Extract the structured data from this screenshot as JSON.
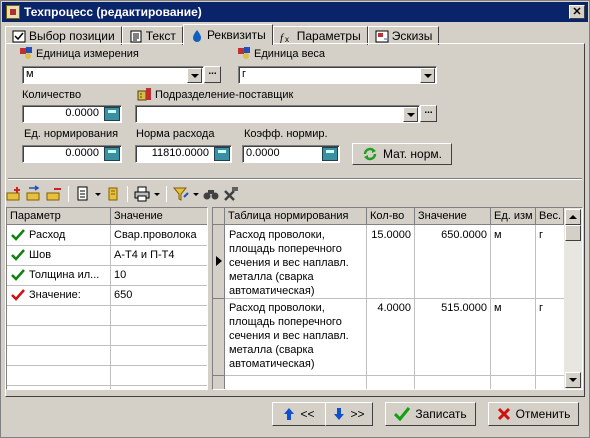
{
  "window": {
    "title": "Техпроцесс (редактирование)",
    "close": "✕"
  },
  "tabs": [
    {
      "label": "Выбор позиции",
      "icon": "select-position-icon"
    },
    {
      "label": "Текст",
      "icon": "text-icon"
    },
    {
      "label": "Реквизиты",
      "icon": "drop-icon"
    },
    {
      "label": "Параметры",
      "icon": "parameters-icon"
    },
    {
      "label": "Эскизы",
      "icon": "sketch-icon"
    }
  ],
  "form": {
    "unit_measure_label": "Единица измерения",
    "unit_measure_value": "м",
    "unit_weight_label": "Единица веса",
    "unit_weight_value": "г",
    "quantity_label": "Количество",
    "quantity_value": "0.0000",
    "supplier_label": "Подразделение-поставщик",
    "supplier_value": "",
    "norm_unit_label": "Ед. нормирования",
    "norm_unit_value": "0.0000",
    "consumption_label": "Норма расхода",
    "consumption_value": "11810.0000",
    "coef_label": "Коэфф. нормир.",
    "coef_value": "0.0000",
    "mat_norm_button": "Мат. норм.",
    "ellipsis": "..."
  },
  "params_grid": {
    "headers": [
      "Параметр",
      "Значение"
    ],
    "rows": [
      {
        "param": "Расход",
        "value": "Свар.проволока",
        "check": "green"
      },
      {
        "param": "Шов",
        "value": "А-Т4 и П-Т4",
        "check": "green"
      },
      {
        "param": "Толщина ил...",
        "value": "10",
        "check": "green"
      },
      {
        "param": "Значение:",
        "value": "650",
        "check": "red"
      }
    ]
  },
  "norm_grid": {
    "headers": [
      "Таблица нормирования",
      "Кол-во",
      "Значение",
      "Ед. изм",
      "Вес."
    ],
    "rows": [
      {
        "text": "Расход проволоки, площадь поперечного сечения и вес наплавл. металла (сварка автоматическая)",
        "qty": "15.0000",
        "value": "650.0000",
        "unit": "м",
        "weight": "г",
        "lines": [
          "Расход проволоки,",
          "площадь поперечного",
          "сечения и вес наплавл.",
          "металла (сварка",
          "автоматическая)"
        ]
      },
      {
        "text": "Расход проволоки, площадь поперечного сечения и вес наплавл. металла (сварка автоматическая)",
        "qty": "4.0000",
        "value": "515.0000",
        "unit": "м",
        "weight": "г",
        "lines": [
          "Расход проволоки,",
          "площадь поперечного",
          "сечения и вес наплавл.",
          "металла (сварка",
          "автоматическая)"
        ]
      }
    ]
  },
  "footer": {
    "prev": "<<",
    "next": ">>",
    "save": "Записать",
    "cancel": "Отменить"
  }
}
